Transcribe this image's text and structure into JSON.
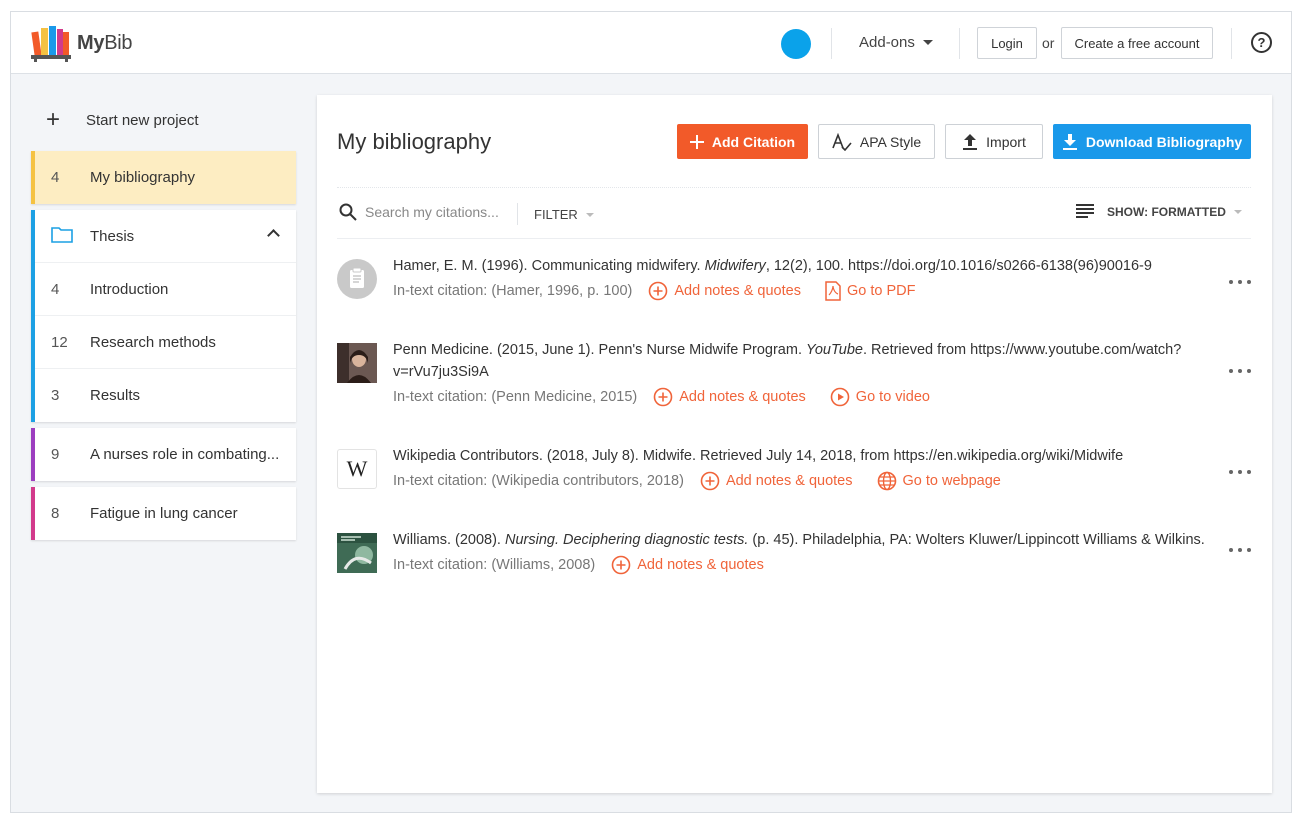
{
  "header": {
    "logo_bold": "My",
    "logo_light": "Bib",
    "addons_label": "Add-ons",
    "login_label": "Login",
    "or_label": "or",
    "create_account_label": "Create a free account",
    "help_label": "?"
  },
  "sidebar": {
    "start_new": "Start new project",
    "active_project": {
      "count": "4",
      "name": "My bibliography"
    },
    "folder": {
      "name": "Thesis",
      "items": [
        {
          "count": "4",
          "name": "Introduction"
        },
        {
          "count": "12",
          "name": "Research methods"
        },
        {
          "count": "3",
          "name": "Results"
        }
      ]
    },
    "projects": [
      {
        "count": "9",
        "name": "A nurses role in combating..."
      },
      {
        "count": "8",
        "name": "Fatigue in lung cancer"
      }
    ]
  },
  "main": {
    "title": "My bibliography",
    "add_citation": "Add Citation",
    "apa_style": "APA Style",
    "import": "Import",
    "download": "Download Bibliography",
    "search_placeholder": "Search my citations...",
    "filter": "FILTER",
    "show": "SHOW: FORMATTED"
  },
  "citations": [
    {
      "pre": "Hamer, E. M. (1996). Communicating midwifery. ",
      "italic": "Midwifery",
      "post": ", 12(2), 100. https://doi.org/10.1016/s0266-6138(96)90016-9",
      "intext": "In-text citation: (Hamer, 1996, p. 100)",
      "notes": "Add notes & quotes",
      "goto": "Go to PDF",
      "thumb": "clipboard-icon"
    },
    {
      "pre": "Penn Medicine. (2015, June 1). Penn's Nurse Midwife Program. ",
      "italic": "YouTube",
      "post": ". Retrieved from https://www.youtube.com/watch?v=rVu7ju3Si9A",
      "intext": "In-text citation: (Penn Medicine, 2015)",
      "notes": "Add notes & quotes",
      "goto": "Go to video",
      "thumb": "video-thumbnail"
    },
    {
      "pre": "Wikipedia Contributors. (2018, July 8). Midwife. Retrieved July 14, 2018, from https://en.wikipedia.org/wiki/Midwife",
      "italic": "",
      "post": "",
      "intext": "In-text citation: (Wikipedia contributors, 2018)",
      "notes": "Add notes & quotes",
      "goto": "Go to webpage",
      "thumb": "wikipedia-icon",
      "thumb_letter": "W"
    },
    {
      "pre": "Williams. (2008). ",
      "italic": "Nursing. Deciphering diagnostic tests.",
      "post": " (p. 45). Philadelphia, PA: Wolters Kluwer/Lippincott Williams & Wilkins.",
      "intext": "In-text citation: (Williams, 2008)",
      "notes": "Add notes & quotes",
      "goto": "",
      "thumb": "book-cover-thumbnail"
    }
  ],
  "colors": {
    "accent_orange": "#f25a29",
    "accent_blue": "#1a99ea",
    "link_orange": "#f0643a",
    "active_bg": "#fdedc2"
  }
}
